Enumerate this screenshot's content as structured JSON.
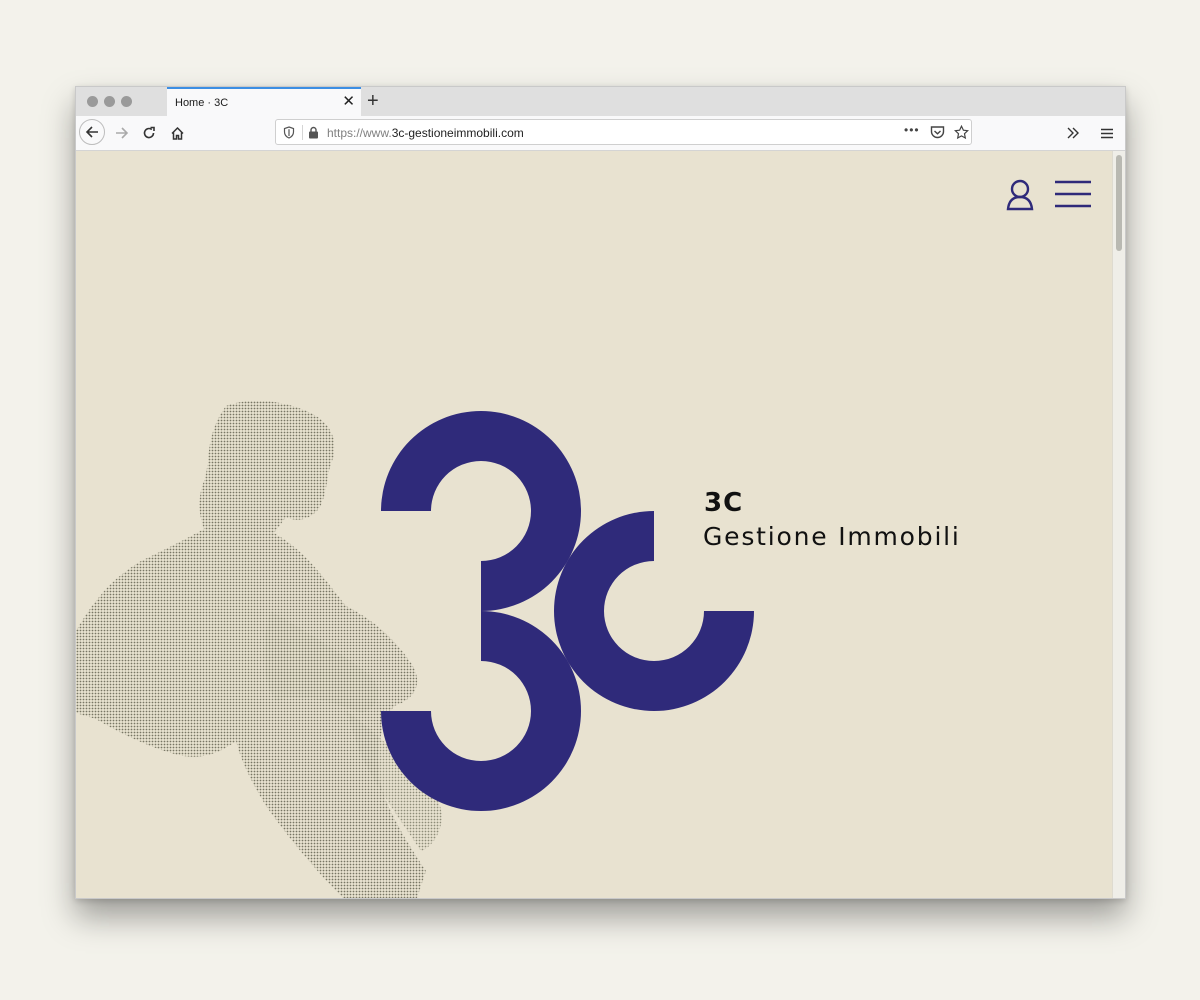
{
  "browser": {
    "tab_title": "Home · 3C",
    "url_prefix": "https://www.",
    "url_domain": "3c-gestioneimmobili.com",
    "page_actions_label": "•••"
  },
  "site": {
    "brand_short": "3C",
    "brand_name": "Gestione Immobili",
    "accent_color": "#2f2a7a",
    "background_color": "#e8e2d0"
  },
  "icons": {
    "account": "user-icon",
    "menu": "hamburger-menu-icon"
  }
}
